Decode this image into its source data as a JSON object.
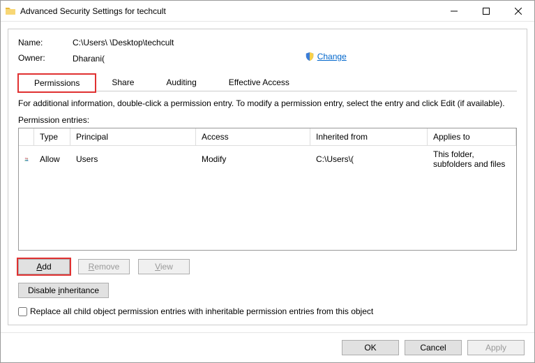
{
  "titlebar": {
    "title": "Advanced Security Settings for techcult"
  },
  "info": {
    "name_label": "Name:",
    "name_value": "C:\\Users\\                              \\Desktop\\techcult",
    "owner_label": "Owner:",
    "owner_value": "Dharani(",
    "change_label": "Change"
  },
  "tabs": {
    "permissions": "Permissions",
    "share": "Share",
    "auditing": "Auditing",
    "effective": "Effective Access"
  },
  "description": "For additional information, double-click a permission entry. To modify a permission entry, select the entry and click Edit (if available).",
  "entries_label": "Permission entries:",
  "table": {
    "headers": {
      "type": "Type",
      "principal": "Principal",
      "access": "Access",
      "inherited": "Inherited from",
      "applies": "Applies to"
    },
    "rows": [
      {
        "type": "Allow",
        "principal": "Users",
        "access": "Modify",
        "inherited": "C:\\Users\\(",
        "applies": "This folder, subfolders and files"
      }
    ]
  },
  "buttons": {
    "add": "Add",
    "remove": "Remove",
    "view": "View",
    "disable_inheritance": "Disable inheritance",
    "ok": "OK",
    "cancel": "Cancel",
    "apply": "Apply"
  },
  "checkbox": {
    "label": "Replace all child object permission entries with inheritable permission entries from this object"
  }
}
